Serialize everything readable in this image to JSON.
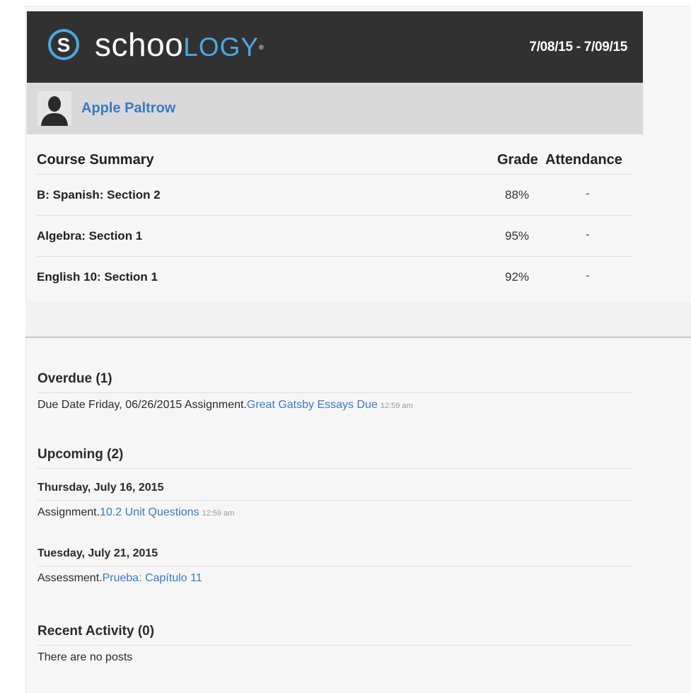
{
  "header": {
    "logo_letter": "S",
    "logo_text_a": "schoo",
    "logo_text_b": "LOGY",
    "logo_tm": "®",
    "date_range": "7/08/15 - 7/09/15"
  },
  "student": {
    "name": "Apple Paltrow",
    "avatar_icon": "person-silhouette-icon"
  },
  "course_summary": {
    "title": "Course Summary",
    "grade_header": "Grade",
    "attendance_header": "Attendance",
    "rows": [
      {
        "course": "B: Spanish: Section 2",
        "grade": "88%",
        "attendance": "-"
      },
      {
        "course": "Algebra: Section 1",
        "grade": "95%",
        "attendance": "-"
      },
      {
        "course": "English 10: Section 1",
        "grade": "92%",
        "attendance": "-"
      }
    ]
  },
  "overdue": {
    "title": "Overdue (1)",
    "items": [
      {
        "prefix": "Due Date Friday, 06/26/2015 Assignment.",
        "link": "Great Gatsby Essays Due",
        "time": "12:59 am"
      }
    ]
  },
  "upcoming": {
    "title": "Upcoming (2)",
    "groups": [
      {
        "date": "Thursday, July 16, 2015",
        "prefix": "Assignment.",
        "link": "10.2 Unit Questions",
        "time": "12:59 am"
      },
      {
        "date": "Tuesday, July 21, 2015",
        "prefix": "Assessment.",
        "link": "Prueba: Capítulo 11",
        "time": ""
      }
    ]
  },
  "recent_activity": {
    "title": "Recent Activity (0)",
    "empty_text": "There are no posts"
  },
  "colors": {
    "header_bg": "#313131",
    "brand_blue": "#4aa9e0",
    "link_blue": "#3b7ac0",
    "student_bar_bg": "#d9d9d9"
  }
}
